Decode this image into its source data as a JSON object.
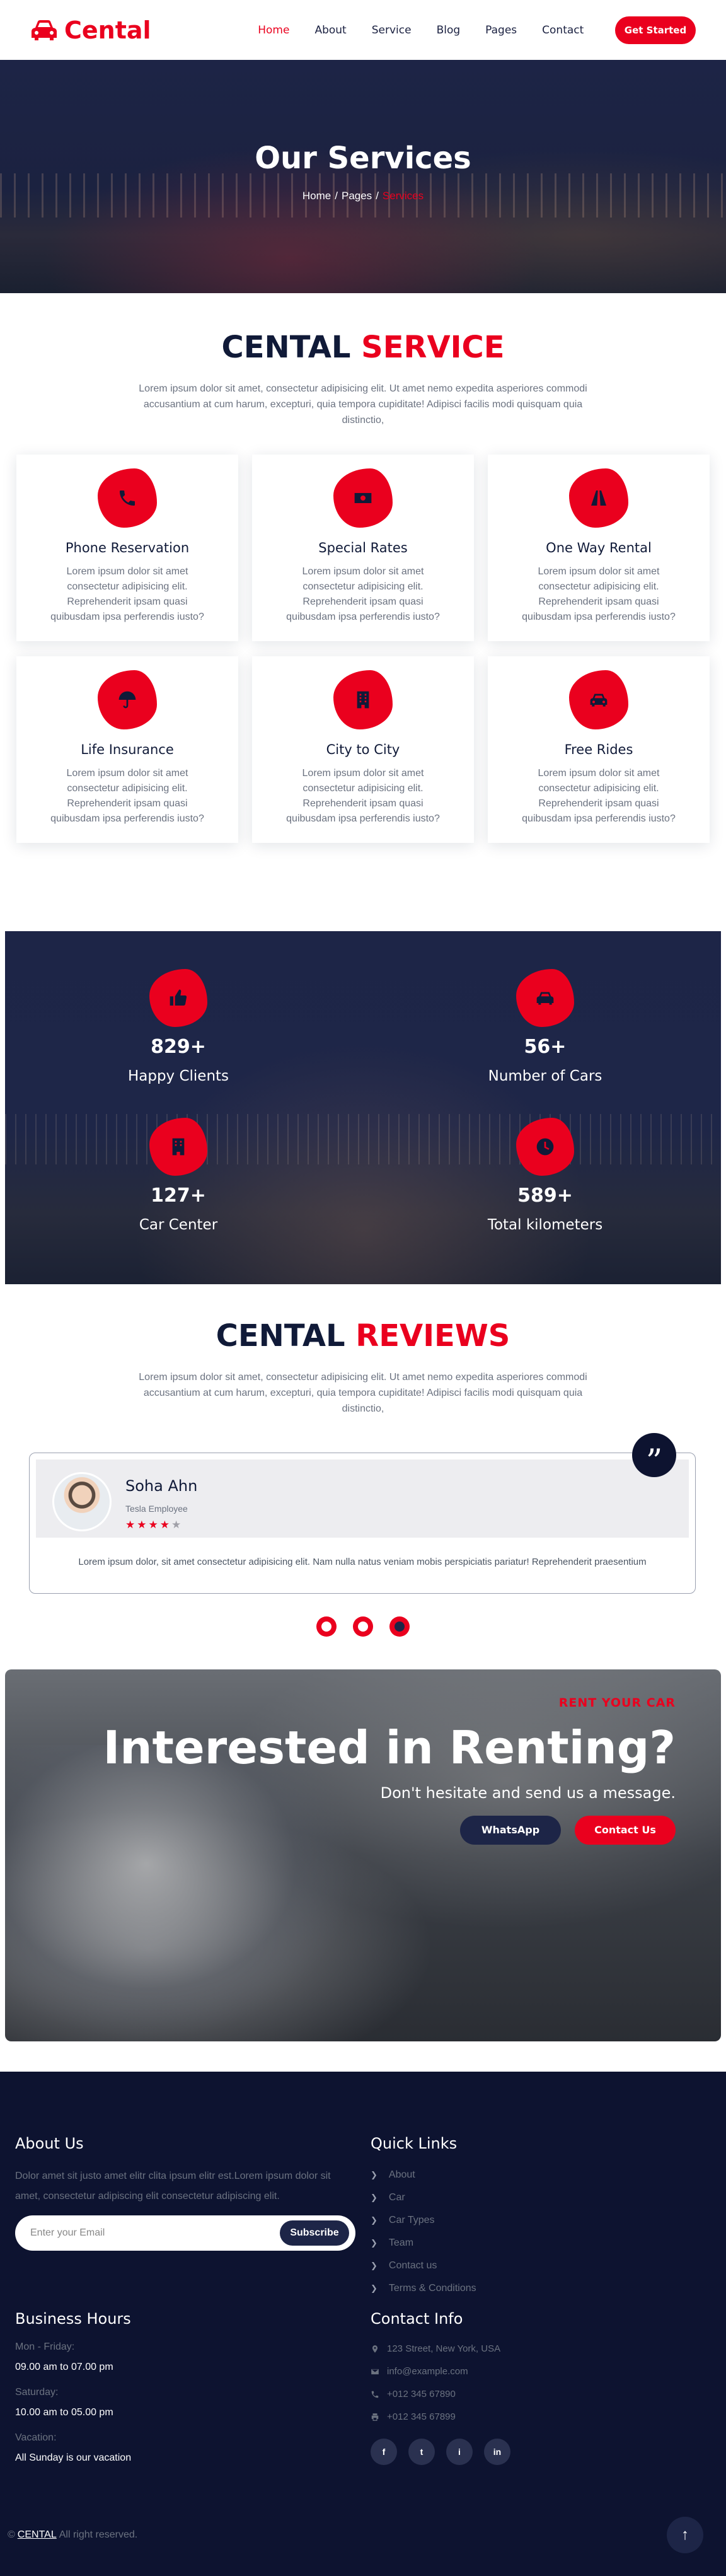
{
  "nav": {
    "brand": "Cental",
    "links": [
      "Home",
      "About",
      "Service",
      "Blog",
      "Pages",
      "Contact"
    ],
    "cta": "Get Started"
  },
  "hero": {
    "title": "Our Services",
    "breadcrumb": [
      "Home",
      "Pages",
      "Services"
    ]
  },
  "services": {
    "title_main": "CENTAL",
    "title_accent": "SERVICE",
    "description": "Lorem ipsum dolor sit amet, consectetur adipisicing elit. Ut amet nemo expedita asperiores commodi accusantium at cum harum, excepturi, quia tempora cupiditate! Adipisci facilis modi quisquam quia distinctio,",
    "items": [
      {
        "title": "Phone Reservation",
        "icon": "phone-icon",
        "text": "Lorem ipsum dolor sit amet consectetur adipisicing elit. Reprehenderit ipsam quasi quibusdam ipsa perferendis iusto?"
      },
      {
        "title": "Special Rates",
        "icon": "money-bill-icon",
        "text": "Lorem ipsum dolor sit amet consectetur adipisicing elit. Reprehenderit ipsam quasi quibusdam ipsa perferendis iusto?"
      },
      {
        "title": "One Way Rental",
        "icon": "road-icon",
        "text": "Lorem ipsum dolor sit amet consectetur adipisicing elit. Reprehenderit ipsam quasi quibusdam ipsa perferendis iusto?"
      },
      {
        "title": "Life Insurance",
        "icon": "umbrella-icon",
        "text": "Lorem ipsum dolor sit amet consectetur adipisicing elit. Reprehenderit ipsam quasi quibusdam ipsa perferendis iusto?"
      },
      {
        "title": "City to City",
        "icon": "building-icon",
        "text": "Lorem ipsum dolor sit amet consectetur adipisicing elit. Reprehenderit ipsam quasi quibusdam ipsa perferendis iusto?"
      },
      {
        "title": "Free Rides",
        "icon": "car-icon",
        "text": "Lorem ipsum dolor sit amet consectetur adipisicing elit. Reprehenderit ipsam quasi quibusdam ipsa perferendis iusto?"
      }
    ]
  },
  "counters": [
    {
      "value": "829+",
      "label": "Happy Clients",
      "icon": "thumbs-up-icon"
    },
    {
      "value": "56+",
      "label": "Number of Cars",
      "icon": "car-icon"
    },
    {
      "value": "127+",
      "label": "Car Center",
      "icon": "building-icon"
    },
    {
      "value": "589+",
      "label": "Total kilometers",
      "icon": "clock-icon"
    }
  ],
  "reviews": {
    "title_main": "CENTAL",
    "title_accent": "REVIEWS",
    "description": "Lorem ipsum dolor sit amet, consectetur adipisicing elit. Ut amet nemo expedita asperiores commodi accusantium at cum harum, excepturi, quia tempora cupiditate! Adipisci facilis modi quisquam quia distinctio,",
    "review": {
      "name": "Soha Ahn",
      "role": "Tesla Employee",
      "rating": 4,
      "max_rating": 5,
      "text": "Lorem ipsum dolor, sit amet consectetur adipisicing elit. Nam nulla natus veniam mobis perspiciatis pariatur! Reprehenderit praesentium"
    },
    "dots": 3,
    "active_dot": 2
  },
  "rent": {
    "tag": "RENT YOUR CAR",
    "title": "Interested in Renting?",
    "subtitle": "Don't hesitate and send us a message.",
    "btn_whatsapp": "WhatsApp",
    "btn_contact": "Contact Us"
  },
  "footer": {
    "about_title": "About Us",
    "about_text": "Dolor amet sit justo amet elitr clita ipsum elitr est.Lorem ipsum dolor sit amet, consectetur adipiscing elit consectetur adipiscing elit.",
    "email_placeholder": "Enter your Email",
    "subscribe": "Subscribe",
    "quick_title": "Quick Links",
    "quick_links": [
      "About",
      "Car",
      "Car Types",
      "Team",
      "Contact us",
      "Terms & Conditions"
    ],
    "hours_title": "Business Hours",
    "hours": [
      {
        "label": "Mon - Friday:",
        "value": "09.00 am to 07.00 pm"
      },
      {
        "label": "Saturday:",
        "value": "10.00 am to 05.00 pm"
      },
      {
        "label": "Vacation:",
        "value": "All Sunday is our vacation"
      }
    ],
    "contact_title": "Contact Info",
    "contact": [
      {
        "icon": "map-pin-icon",
        "text": "123 Street, New York, USA"
      },
      {
        "icon": "envelope-icon",
        "text": "info@example.com"
      },
      {
        "icon": "phone-icon",
        "text": "+012 345 67890"
      },
      {
        "icon": "print-icon",
        "text": "+012 345 67899"
      }
    ],
    "socials": [
      "f",
      "t",
      "i",
      "in"
    ],
    "copyright_brand": "CENTAL",
    "copyright_text": "All right reserved."
  },
  "colors": {
    "accent": "#ea001e",
    "navy": "#101a38",
    "footer": "#0d1330"
  }
}
